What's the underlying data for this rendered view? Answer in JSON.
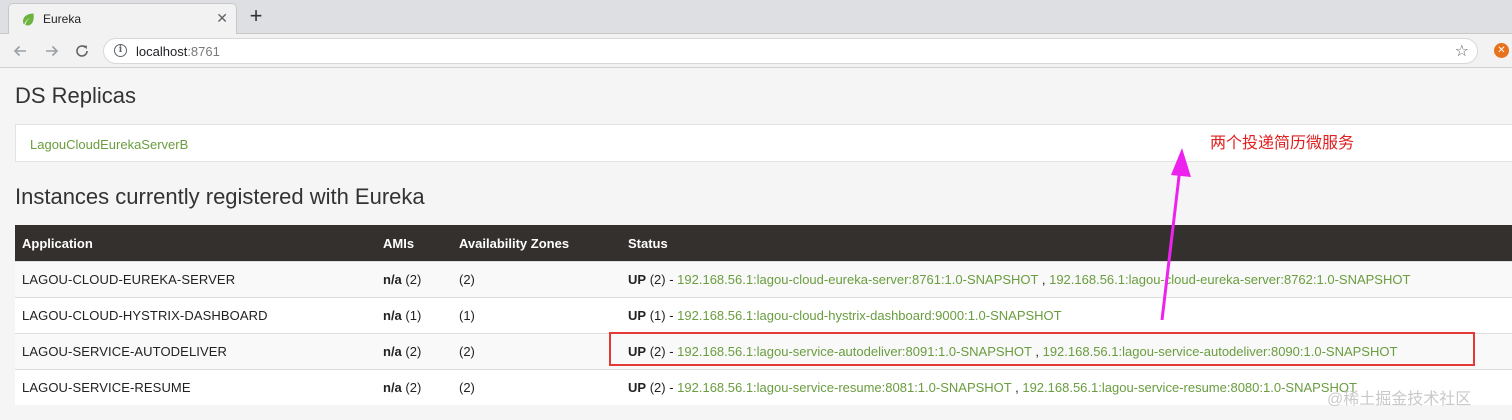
{
  "browser": {
    "tab_title": "Eureka",
    "tab_close": "✕",
    "new_tab": "+",
    "url_host": "localhost",
    "url_port": ":8761",
    "info_glyph": "i",
    "icons": {
      "favicon": "spring-leaf-icon",
      "back": "back-arrow-icon",
      "forward": "forward-arrow-icon",
      "reload": "reload-icon",
      "bookmark": "star-icon",
      "extension": "extension-icon"
    },
    "accent": "#6a9d3f"
  },
  "replicas": {
    "heading": "DS Replicas",
    "link": "LagouCloudEurekaServerB"
  },
  "instances": {
    "heading": "Instances currently registered with Eureka",
    "columns": [
      "Application",
      "AMIs",
      "Availability Zones",
      "Status"
    ],
    "rows": [
      {
        "application": "LAGOU-CLOUD-EUREKA-SERVER",
        "ami_label": "n/a",
        "ami_count": "(2)",
        "zones": "(2)",
        "status_label": "UP",
        "status_count": "(2) -",
        "instances": [
          "192.168.56.1:lagou-cloud-eureka-server:8761:1.0-SNAPSHOT",
          "192.168.56.1:lagou-cloud-eureka-server:8762:1.0-SNAPSHOT"
        ]
      },
      {
        "application": "LAGOU-CLOUD-HYSTRIX-DASHBOARD",
        "ami_label": "n/a",
        "ami_count": "(1)",
        "zones": "(1)",
        "status_label": "UP",
        "status_count": "(1) -",
        "instances": [
          "192.168.56.1:lagou-cloud-hystrix-dashboard:9000:1.0-SNAPSHOT"
        ]
      },
      {
        "application": "LAGOU-SERVICE-AUTODELIVER",
        "ami_label": "n/a",
        "ami_count": "(2)",
        "zones": "(2)",
        "status_label": "UP",
        "status_count": "(2) -",
        "instances": [
          "192.168.56.1:lagou-service-autodeliver:8091:1.0-SNAPSHOT",
          "192.168.56.1:lagou-service-autodeliver:8090:1.0-SNAPSHOT"
        ]
      },
      {
        "application": "LAGOU-SERVICE-RESUME",
        "ami_label": "n/a",
        "ami_count": "(2)",
        "zones": "(2)",
        "status_label": "UP",
        "status_count": "(2) -",
        "instances": [
          "192.168.56.1:lagou-service-resume:8081:1.0-SNAPSHOT",
          "192.168.56.1:lagou-service-resume:8080:1.0-SNAPSHOT"
        ]
      }
    ],
    "separator": " , "
  },
  "annotation": {
    "text": "两个投递简历微服务",
    "color": "#e02020",
    "arrow_color": "#ee22ee",
    "box_color": "#e53935"
  },
  "watermark": "@稀土掘金技术社区"
}
